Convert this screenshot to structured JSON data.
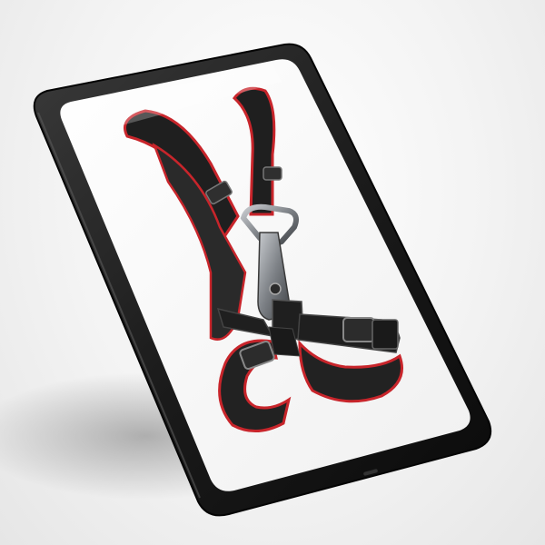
{
  "scene": {
    "subject": "tablet-displaying-climbing-harness",
    "colors": {
      "background": "#f2f2f2",
      "tablet_frame": "#1a1a1a",
      "tablet_bezel": "#0d0d0d",
      "screen": "#fafafa",
      "webbing": "#1e1e1e",
      "trim": "#c8252b",
      "metal": "#8a8d91"
    }
  }
}
